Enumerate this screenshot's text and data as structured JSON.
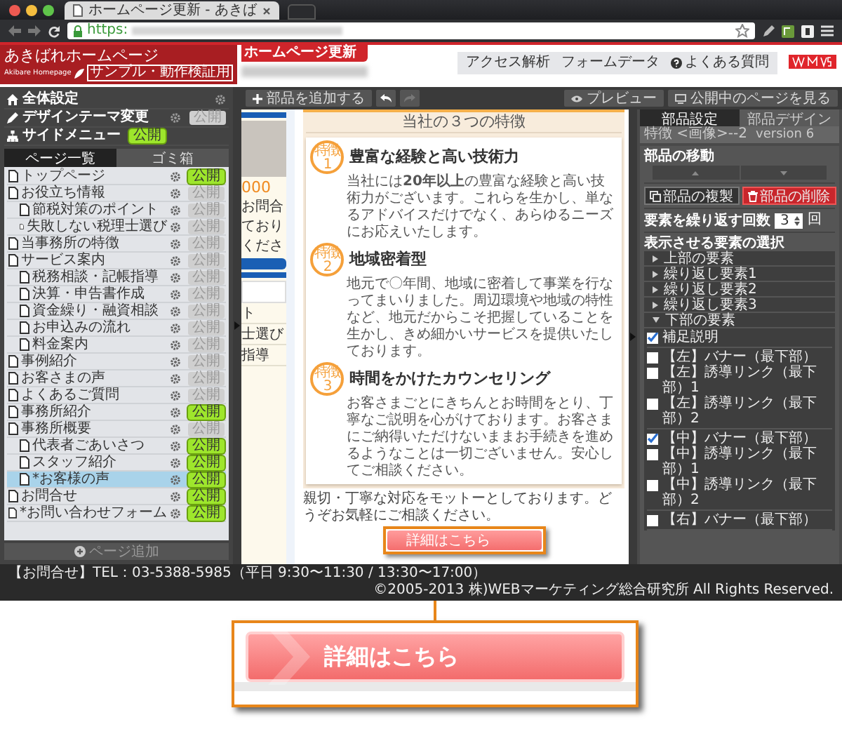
{
  "browser": {
    "tab_title": "ホームページ更新 - あきば",
    "url_scheme": "https:"
  },
  "header": {
    "logo_title": "あきばれホームページ",
    "logo_subtitle": "Akibare Homepage",
    "logo_badge": "サンプル・動作検証用",
    "page_tag": "ホームページ更新",
    "nav": [
      {
        "label": "アクセス解析",
        "kind": "text"
      },
      {
        "label": "フォームデータ",
        "kind": "text"
      },
      {
        "label": "よくある質問",
        "kind": "help"
      }
    ]
  },
  "sidebar": {
    "settings": [
      {
        "label": "全体設定",
        "kind": "home",
        "gear": true
      },
      {
        "label": "デザインテーマ変更",
        "kind": "pen",
        "gear": true,
        "toggle": {
          "label": "公開",
          "on": false
        }
      },
      {
        "label": "サイドメニュー",
        "kind": "sitemap",
        "gear": false,
        "toggle": {
          "label": "公開",
          "on": true
        }
      }
    ],
    "tabs": [
      {
        "label": "ページ一覧",
        "selected": true
      },
      {
        "label": "ゴミ箱",
        "selected": false
      }
    ],
    "pages": [
      {
        "label": "トップページ",
        "toggle": "公開",
        "public": true,
        "selected": false
      },
      {
        "label": "お役立ち情報",
        "toggle": "公開",
        "public": false,
        "selected": false,
        "children": [
          {
            "label": "節税対策のポイント",
            "toggle": "公開",
            "public": false,
            "selected": false
          },
          {
            "label": "失敗しない税理士選び",
            "toggle": "公開",
            "public": false,
            "selected": false
          }
        ]
      },
      {
        "label": "当事務所の特徴",
        "toggle": "公開",
        "public": false,
        "selected": false
      },
      {
        "label": "サービス案内",
        "toggle": "公開",
        "public": false,
        "selected": false,
        "children": [
          {
            "label": "税務相談・記帳指導",
            "toggle": "公開",
            "public": false,
            "selected": false
          },
          {
            "label": "決算・申告書作成",
            "toggle": "公開",
            "public": false,
            "selected": false
          },
          {
            "label": "資金繰り・融資相談",
            "toggle": "公開",
            "public": false,
            "selected": false
          },
          {
            "label": "お申込みの流れ",
            "toggle": "公開",
            "public": false,
            "selected": false
          },
          {
            "label": "料金案内",
            "toggle": "公開",
            "public": false,
            "selected": false
          }
        ]
      },
      {
        "label": "事例紹介",
        "toggle": "公開",
        "public": false,
        "selected": false
      },
      {
        "label": "お客さまの声",
        "toggle": "公開",
        "public": false,
        "selected": false
      },
      {
        "label": "よくあるご質問",
        "toggle": "公開",
        "public": false,
        "selected": false
      },
      {
        "label": "事務所紹介",
        "toggle": "公開",
        "public": true,
        "selected": false
      },
      {
        "label": "事務所概要",
        "toggle": "公開",
        "public": false,
        "selected": false,
        "children": [
          {
            "label": "代表者ごあいさつ",
            "toggle": "公開",
            "public": true,
            "selected": false
          },
          {
            "label": "スタッフ紹介",
            "toggle": "公開",
            "public": true,
            "selected": false
          },
          {
            "label": "*お客様の声",
            "toggle": "公開",
            "public": true,
            "selected": true
          }
        ]
      },
      {
        "label": "お問合せ",
        "toggle": "公開",
        "public": true,
        "selected": false
      },
      {
        "label": "*お問い合わせフォーム",
        "toggle": "公開",
        "public": true,
        "selected": false
      }
    ],
    "add_page": "ページ追加"
  },
  "toolbar": {
    "add_part": "部品を追加する",
    "undo_enabled": true,
    "redo_enabled": false,
    "preview": "プレビュー",
    "view_live": "公開中のページを見る"
  },
  "preview": {
    "side": {
      "price": "000",
      "lines": [
        "お問合",
        "ており",
        "くださ"
      ],
      "menu": [
        "ト",
        "士選び",
        "指導"
      ]
    },
    "features": {
      "title": "当社の３つの特徴",
      "items": [
        {
          "badge": "特徴",
          "number": "1",
          "heading": "豊富な経験と高い技術力",
          "body": "当社には**20年以上**の豊富な経験と高い技術力がございます。これらを生かし、単なるアドバイスだけでなく、あらゆるニーズにお応えいたします。"
        },
        {
          "badge": "特徴",
          "number": "2",
          "heading": "地域密着型",
          "body": "地元で〇年間、地域に密着して事業を行なってまいりました。周辺環境や地域の特性など、地元だからこそ把握していることを生かし、きめ細かいサービスを提供いたしております。"
        },
        {
          "badge": "特徴",
          "number": "3",
          "heading": "時間をかけたカウンセリング",
          "body": "お客さまごとにきちんとお時間をとり、丁寧なご説明を心がけております。お客さまにご納得いただけないままお手続きを進めるようなことは一切ございません。安心してご相談ください。"
        }
      ]
    },
    "motto": "親切・丁寧な対応をモットーとしております。どうぞお気軽にご相談ください。",
    "detail_button": {
      "label": "詳細はこちら",
      "highlighted": true
    }
  },
  "right_panel": {
    "tabs": [
      {
        "label": "部品設定",
        "selected": true
      },
      {
        "label": "部品デザイン",
        "selected": false
      }
    ],
    "part_name": "特徴 <画像>--2",
    "version": "version 6",
    "move_title": "部品の移動",
    "copy": "部品の複製",
    "delete": "部品の削除",
    "repeat_title": "要素を繰り返す回数",
    "repeat_value": "3",
    "repeat_unit": "回",
    "select_title": "表示させる要素の選択",
    "sections": [
      {
        "label": "上部の要素",
        "expanded": false
      },
      {
        "label": "繰り返し要素1",
        "expanded": false
      },
      {
        "label": "繰り返し要素2",
        "expanded": false
      },
      {
        "label": "繰り返し要素3",
        "expanded": false
      },
      {
        "label": "下部の要素",
        "expanded": true
      }
    ],
    "option_groups": [
      {
        "options": [
          {
            "label": "補足説明",
            "checked": true
          }
        ]
      },
      {
        "options": [
          {
            "label": "【左】バナー（最下部）",
            "checked": false
          },
          {
            "label": "【左】誘導リンク（最下部）1",
            "checked": false
          },
          {
            "label": "【左】誘導リンク（最下部）2",
            "checked": false
          }
        ]
      },
      {
        "options": [
          {
            "label": "【中】バナー（最下部）",
            "checked": true
          },
          {
            "label": "【中】誘導リンク（最下部）1",
            "checked": false
          },
          {
            "label": "【中】誘導リンク（最下部）2",
            "checked": false
          }
        ]
      },
      {
        "options": [
          {
            "label": "【右】バナー（最下部）",
            "checked": false
          }
        ]
      }
    ]
  },
  "status_bar": {
    "contact": "【お問合せ】TEL：03-5388-5985（平日 9:30〜11:30 / 13:30〜17:00）",
    "copyright": "©2005-2013 株)WEBマーケティング総合研究所 All Rights Reserved."
  },
  "callout": {
    "label": "詳細はこちら"
  }
}
